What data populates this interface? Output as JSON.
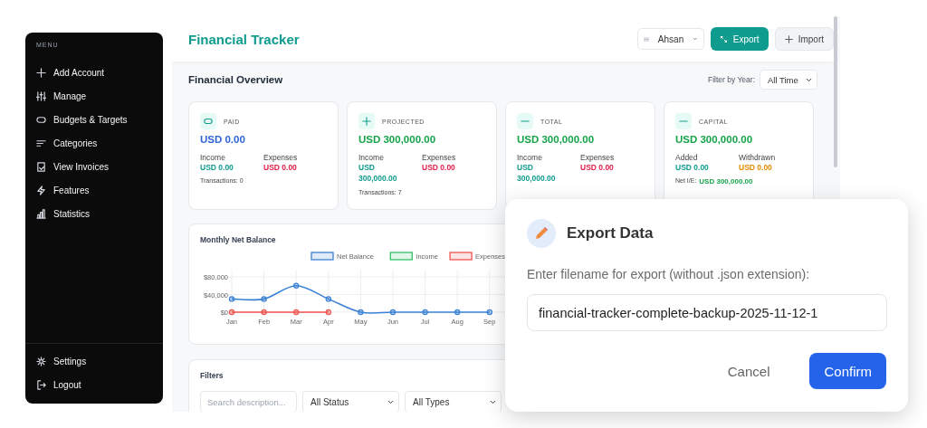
{
  "sidebar": {
    "heading": "MENU",
    "items": [
      {
        "label": "Add Account"
      },
      {
        "label": "Manage"
      },
      {
        "label": "Budgets & Targets"
      },
      {
        "label": "Categories"
      },
      {
        "label": "View Invoices"
      },
      {
        "label": "Features"
      },
      {
        "label": "Statistics"
      }
    ],
    "footer_items": [
      {
        "label": "Settings"
      },
      {
        "label": "Logout"
      }
    ]
  },
  "header": {
    "title": "Financial Tracker",
    "user": "Ahsan",
    "buttons": [
      {
        "kind": "primary",
        "label": "Export"
      },
      {
        "kind": "secondary",
        "label": "Import"
      }
    ]
  },
  "overview": {
    "title": "Financial Overview",
    "filter_label": "Filter by Year:",
    "filter_value": "All Time",
    "cards": [
      {
        "label": "PAID",
        "amount": "USD 0.00",
        "color": "#2f63d8",
        "stats": [
          {
            "label": "Income",
            "value": "USD 0.00",
            "color": "#0f9b8e"
          },
          {
            "label": "Expenses",
            "value": "USD 0.00",
            "color": "#e11d48"
          }
        ],
        "footer": {
          "label": "Transactions: 0"
        }
      },
      {
        "label": "PROJECTED",
        "amount": "USD 300,000.00",
        "color": "#17a34a",
        "stats": [
          {
            "label": "Income",
            "value": "USD 300,000.00",
            "color": "#0f9b8e"
          },
          {
            "label": "Expenses",
            "value": "USD 0.00",
            "color": "#e11d48"
          }
        ],
        "footer": {
          "label": "Transactions: 7"
        }
      },
      {
        "label": "TOTAL",
        "amount": "USD 300,000.00",
        "color": "#17a34a",
        "stats": [
          {
            "label": "Income",
            "value": "USD 300,000.00",
            "color": "#0f9b8e"
          },
          {
            "label": "Expenses",
            "value": "USD 0.00",
            "color": "#e11d48"
          }
        ]
      },
      {
        "label": "CAPITAL",
        "amount": "USD 300,000.00",
        "color": "#17a34a",
        "stats": [
          {
            "label": "Added",
            "value": "USD 0.00",
            "color": "#0f9b8e"
          },
          {
            "label": "Withdrawn",
            "value": "USD 0.00",
            "color": "#e08a00"
          }
        ],
        "footer": {
          "label": "Net I/E:",
          "value": "USD 300,000.00"
        }
      }
    ]
  },
  "monthly_chart": {
    "title": "Monthly Net Balance",
    "chart_data": {
      "type": "line",
      "categories": [
        "Jan",
        "Feb",
        "Mar",
        "Apr",
        "May",
        "Jun",
        "Jul",
        "Aug",
        "Sep"
      ],
      "ylim": [
        0,
        80000
      ],
      "yticks": [
        {
          "value": 0,
          "label": "$0"
        },
        {
          "value": 40000,
          "label": "$40,000"
        },
        {
          "value": 80000,
          "label": "$80,000"
        }
      ],
      "grid": true,
      "legend": "top",
      "series": [
        {
          "name": "Net Balance",
          "color": "#3b82d6",
          "marker": true,
          "values": [
            30000,
            30000,
            60000,
            30000,
            0,
            0,
            0,
            0,
            0
          ]
        },
        {
          "name": "Income",
          "color": "#34c26a",
          "marker": true,
          "values": [
            null,
            null,
            null,
            null,
            null,
            null,
            null,
            null,
            null
          ]
        },
        {
          "name": "Expenses",
          "color": "#ef5350",
          "marker": true,
          "values": [
            0,
            0,
            0,
            0,
            null,
            null,
            null,
            null,
            null
          ]
        }
      ]
    }
  },
  "filters": {
    "title": "Filters",
    "search_placeholder": "Search description...",
    "selects": [
      "All Status",
      "All Types"
    ]
  },
  "dialog": {
    "title": "Export Data",
    "prompt": "Enter filename for export (without .json extension):",
    "value": "financial-tracker-complete-backup-2025-11-12-1",
    "buttons": [
      {
        "kind": "text",
        "label": "Cancel"
      },
      {
        "kind": "primary",
        "label": "Confirm"
      }
    ]
  }
}
